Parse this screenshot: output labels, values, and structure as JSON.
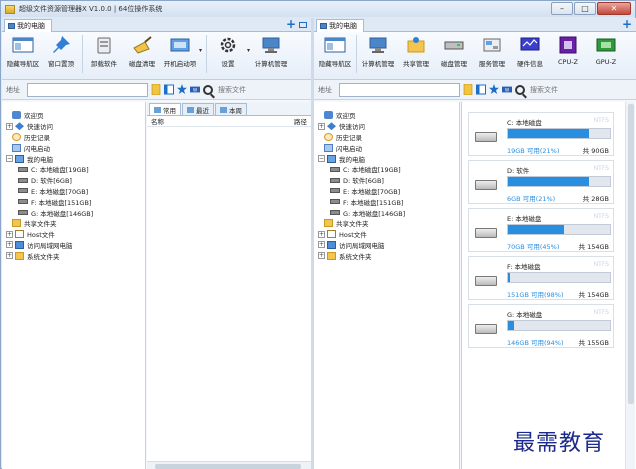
{
  "window": {
    "title": "超级文件资源管理器X V1.0.0 | 64位操作系统",
    "buttons": {
      "minimize": "–",
      "maximize": "□",
      "close": "✕"
    }
  },
  "left": {
    "tab_label": "我的电脑",
    "toolbar": [
      {
        "label": "隐藏导航区",
        "icon": "layout-icon"
      },
      {
        "label": "窗口置顶",
        "icon": "pin-icon"
      },
      {
        "label": "卸载软件",
        "icon": "uninstall-icon"
      },
      {
        "label": "磁盘清理",
        "icon": "broom-icon"
      },
      {
        "label": "开机启动项",
        "icon": "startup-icon"
      },
      {
        "label": "设置",
        "icon": "gear-icon"
      },
      {
        "label": "计算机管理",
        "icon": "computer-icon"
      }
    ],
    "address_label": "地址",
    "search_placeholder": "搜索文件",
    "tree": [
      {
        "label": "欢迎页",
        "icon": "welcome",
        "indent": 1,
        "exp": ""
      },
      {
        "label": "快速访问",
        "icon": "quick",
        "indent": 0,
        "exp": "+"
      },
      {
        "label": "历史记录",
        "icon": "history",
        "indent": 1,
        "exp": ""
      },
      {
        "label": "闪电启动",
        "icon": "flash",
        "indent": 1,
        "exp": ""
      },
      {
        "label": "我的电脑",
        "icon": "pc",
        "indent": 0,
        "exp": "−"
      },
      {
        "label": "C: 本地磁盘[19GB]",
        "icon": "drive",
        "indent": 2,
        "exp": ""
      },
      {
        "label": "D: 软件[6GB]",
        "icon": "drive",
        "indent": 2,
        "exp": ""
      },
      {
        "label": "E: 本地磁盘[70GB]",
        "icon": "drive",
        "indent": 2,
        "exp": ""
      },
      {
        "label": "F: 本地磁盘[151GB]",
        "icon": "drive",
        "indent": 2,
        "exp": ""
      },
      {
        "label": "G: 本地磁盘[146GB]",
        "icon": "drive",
        "indent": 2,
        "exp": ""
      },
      {
        "label": "共享文件夹",
        "icon": "folder",
        "indent": 1,
        "exp": ""
      },
      {
        "label": "Host文件",
        "icon": "host",
        "indent": 0,
        "exp": "+"
      },
      {
        "label": "访问局域网电脑",
        "icon": "net",
        "indent": 0,
        "exp": "+"
      },
      {
        "label": "系统文件夹",
        "icon": "folder",
        "indent": 0,
        "exp": "+"
      }
    ],
    "list_tabs": [
      "常用",
      "最近",
      "本周"
    ],
    "list_columns": {
      "name": "名称",
      "path": "路径"
    }
  },
  "right": {
    "tab_label": "我的电脑",
    "toolbar": [
      {
        "label": "隐藏导航区",
        "icon": "layout-icon"
      },
      {
        "label": "计算机管理",
        "icon": "computer-icon"
      },
      {
        "label": "共享管理",
        "icon": "share-icon"
      },
      {
        "label": "磁盘管理",
        "icon": "disk-icon"
      },
      {
        "label": "服务管理",
        "icon": "service-icon"
      },
      {
        "label": "硬件信息",
        "icon": "hardware-icon"
      },
      {
        "label": "CPU-Z",
        "icon": "cpuz-icon"
      },
      {
        "label": "GPU-Z",
        "icon": "gpuz-icon"
      }
    ],
    "address_label": "地址",
    "search_placeholder": "搜索文件",
    "drives": [
      {
        "name": "C: 本地磁盘",
        "fs": "NTFS",
        "free": "19GB 可用(21%)",
        "total": "共 90GB",
        "used_fraction": 0.79
      },
      {
        "name": "D: 软件",
        "fs": "NTFS",
        "free": "6GB 可用(21%)",
        "total": "共 28GB",
        "used_fraction": 0.79
      },
      {
        "name": "E: 本地磁盘",
        "fs": "NTFS",
        "free": "70GB 可用(45%)",
        "total": "共 154GB",
        "used_fraction": 0.55
      },
      {
        "name": "F: 本地磁盘",
        "fs": "NTFS",
        "free": "151GB 可用(98%)",
        "total": "共 154GB",
        "used_fraction": 0.02
      },
      {
        "name": "G: 本地磁盘",
        "fs": "NTFS",
        "free": "146GB 可用(94%)",
        "total": "共 155GB",
        "used_fraction": 0.06
      }
    ]
  },
  "watermark": "最需教育",
  "colors": {
    "accent": "#2a8ee0",
    "frame": "#dfe9f5"
  }
}
